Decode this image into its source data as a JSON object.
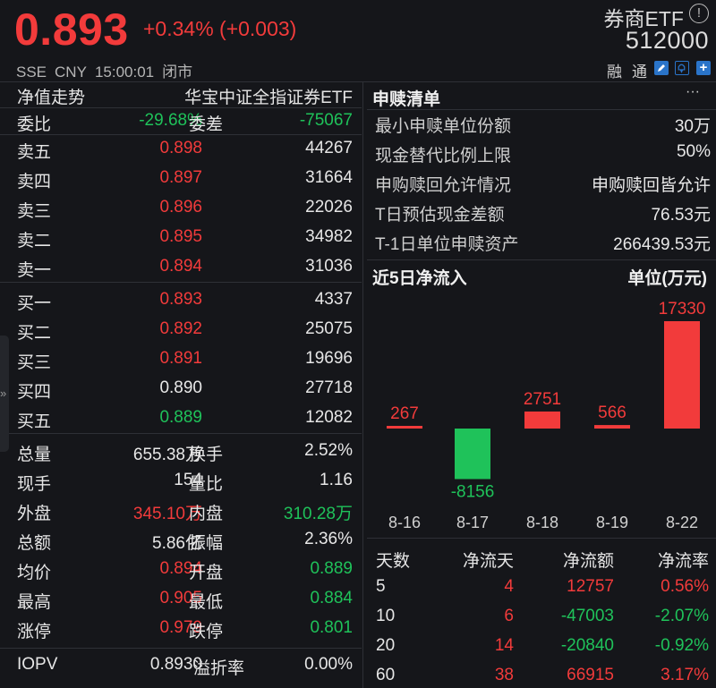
{
  "header": {
    "price": "0.893",
    "change": "+0.34% (+0.003)",
    "exchange": "SSE",
    "currency": "CNY",
    "time": "15:00:01",
    "status": "闭市",
    "etf_name": "券商ETF",
    "info_icon": "!",
    "etf_code": "512000",
    "tag_rong": "融",
    "tag_tong": "通",
    "icons": [
      "edit-icon",
      "bell-icon",
      "plus-icon"
    ],
    "colors": {
      "up": "#f23b3b",
      "down": "#1fc25a",
      "accent": "#2a74c9"
    }
  },
  "left": {
    "nav_left": "净值走势",
    "nav_right": "华宝中证全指证券ETF",
    "weibi_label": "委比",
    "weibi_value": "-29.68%",
    "weicha_label": "委差",
    "weicha_value": "-75067",
    "asks": [
      {
        "label": "卖五",
        "price": "0.898",
        "vol": "44267",
        "color": "red"
      },
      {
        "label": "卖四",
        "price": "0.897",
        "vol": "31664",
        "color": "red"
      },
      {
        "label": "卖三",
        "price": "0.896",
        "vol": "22026",
        "color": "red"
      },
      {
        "label": "卖二",
        "price": "0.895",
        "vol": "34982",
        "color": "red"
      },
      {
        "label": "卖一",
        "price": "0.894",
        "vol": "31036",
        "color": "red"
      }
    ],
    "bids": [
      {
        "label": "买一",
        "price": "0.893",
        "vol": "4337",
        "color": "red"
      },
      {
        "label": "买二",
        "price": "0.892",
        "vol": "25075",
        "color": "red"
      },
      {
        "label": "买三",
        "price": "0.891",
        "vol": "19696",
        "color": "red"
      },
      {
        "label": "买四",
        "price": "0.890",
        "vol": "27718",
        "color": "white"
      },
      {
        "label": "买五",
        "price": "0.889",
        "vol": "12082",
        "color": "green"
      }
    ],
    "stats": [
      {
        "k1": "总量",
        "v1": "655.38万",
        "c1": "white",
        "k2": "换手",
        "v2": "2.52%",
        "c2": "white"
      },
      {
        "k1": "现手",
        "v1": "154",
        "c1": "white",
        "k2": "量比",
        "v2": "1.16",
        "c2": "white"
      },
      {
        "k1": "外盘",
        "v1": "345.10万",
        "c1": "red",
        "k2": "内盘",
        "v2": "310.28万",
        "c2": "green"
      },
      {
        "k1": "总额",
        "v1": "5.86亿",
        "c1": "white",
        "k2": "振幅",
        "v2": "2.36%",
        "c2": "white"
      },
      {
        "k1": "均价",
        "v1": "0.894",
        "c1": "red",
        "k2": "开盘",
        "v2": "0.889",
        "c2": "green"
      },
      {
        "k1": "最高",
        "v1": "0.905",
        "c1": "red",
        "k2": "最低",
        "v2": "0.884",
        "c2": "green"
      },
      {
        "k1": "涨停",
        "v1": "0.979",
        "c1": "red",
        "k2": "跌停",
        "v2": "0.801",
        "c2": "green"
      }
    ],
    "iopv_label": "IOPV",
    "iopv_value": "0.8930",
    "premium_label": "溢折率",
    "premium_value": "0.00%",
    "side_arrow": "»"
  },
  "right": {
    "sg_title": "申赎清单",
    "sg_more": "···",
    "sg_rows": [
      {
        "k": "最小申赎单位份额",
        "v": "30万"
      },
      {
        "k": "现金替代比例上限",
        "v": "50%"
      },
      {
        "k": "申购赎回允许情况",
        "v": "申购赎回皆允许"
      },
      {
        "k": "T日预估现金差额",
        "v": "76.53元"
      },
      {
        "k": "T-1日单位申赎资产",
        "v": "266439.53元"
      }
    ],
    "flow_title": "近5日净流入",
    "flow_unit": "单位(万元)",
    "flow_table": {
      "headers": [
        "天数",
        "净流天",
        "净流额",
        "净流率"
      ],
      "rows": [
        {
          "days": "5",
          "flow_days": "4",
          "amount": "12757",
          "rate": "0.56%",
          "c": "red"
        },
        {
          "days": "10",
          "flow_days": "6",
          "amount": "-47003",
          "rate": "-2.07%",
          "c": "green"
        },
        {
          "days": "20",
          "flow_days": "14",
          "amount": "-20840",
          "rate": "-0.92%",
          "c": "green"
        },
        {
          "days": "60",
          "flow_days": "38",
          "amount": "66915",
          "rate": "3.17%",
          "c": "red"
        }
      ]
    }
  },
  "chart_data": {
    "type": "bar",
    "categories": [
      "8-16",
      "8-17",
      "8-18",
      "8-19",
      "8-22"
    ],
    "values": [
      267,
      -8156,
      2751,
      566,
      17330
    ],
    "title": "近5日净流入",
    "ylabel": "单位(万元)",
    "grid": false
  }
}
